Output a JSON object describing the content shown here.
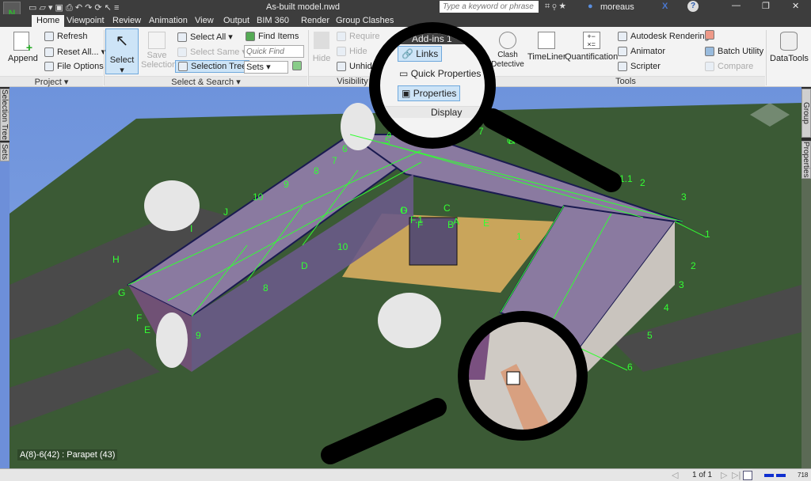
{
  "title": "As-built model.nwd",
  "search_placeholder": "Type a keyword or phrase",
  "user": "moreaus",
  "tabs": [
    "Home",
    "Viewpoint",
    "Review",
    "Animation",
    "View",
    "Output",
    "BIM 360",
    "Render",
    "Group Clashes"
  ],
  "ribbon": {
    "project": {
      "append": "Append",
      "refresh": "Refresh",
      "reset_all": "Reset All...",
      "file_options": "File Options",
      "label": "Project"
    },
    "select_search": {
      "select": "Select",
      "save_selection": "Save Selection",
      "select_all": "Select All",
      "select_same": "Select Same",
      "selection_tree": "Selection Tree",
      "find_items": "Find Items",
      "quick_find_placeholder": "Quick Find",
      "sets": "Sets",
      "label": "Select & Search"
    },
    "visibility": {
      "hide": "Hide",
      "require": "Require",
      "hide_unselected": "Hide",
      "unhide": "Unhide All",
      "label": "Visibility"
    },
    "display": {
      "header": "Add-ins 1",
      "links": "Links",
      "quick_properties": "Quick Properties",
      "properties": "Properties",
      "label": "Display"
    },
    "tools": {
      "clash_detective": "Clash Detective",
      "timeliner": "TimeLiner",
      "quantification": "Quantification",
      "autodesk_rendering": "Autodesk Rendering",
      "animator": "Animator",
      "scripter": "Scripter",
      "batch_utility": "Batch Utility",
      "compare": "Compare",
      "label": "Tools"
    },
    "datatools": "DataTools"
  },
  "left_dock": [
    "Selection Tree",
    "Sets"
  ],
  "right_dock": [
    "Group Clashes",
    "Properties"
  ],
  "grid_labels": [
    "1",
    "2",
    "3",
    "4",
    "5",
    "6",
    "7",
    "8",
    "9",
    "10",
    "J",
    "I",
    "H",
    "G",
    "F",
    "E",
    "D",
    "C",
    "B",
    "A",
    "1",
    "1.1",
    "2",
    "3",
    "4",
    "5",
    "6",
    "G",
    "F.1",
    "F",
    "E",
    "D",
    "8",
    "9",
    "10",
    "7",
    "H",
    "G"
  ],
  "hover_label": "A(8)-6(42) : Parapet (43)",
  "status": {
    "page": "1 of 1",
    "memory": "718"
  },
  "colors": {
    "grid": "#33ff33",
    "sky": "#6b8fd6",
    "ground": "#3b5a35",
    "roof": "#8a7aa0"
  }
}
